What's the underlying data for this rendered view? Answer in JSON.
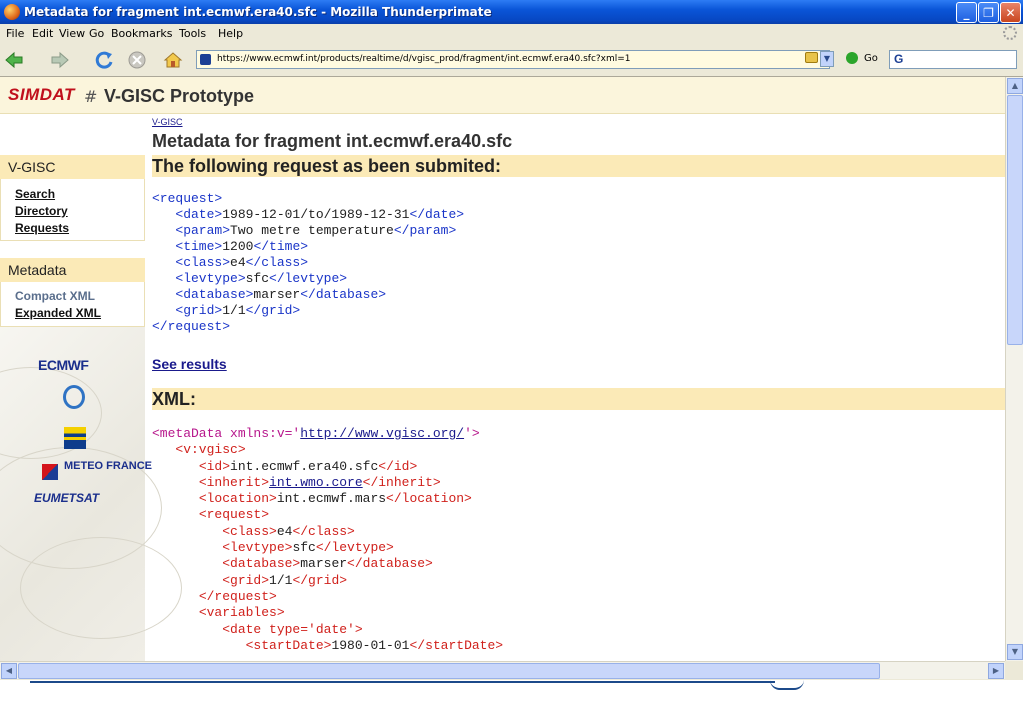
{
  "window": {
    "title": "Metadata for fragment int.ecmwf.era40.sfc - Mozilla Thunderprimate"
  },
  "menu": [
    "File",
    "Edit",
    "View",
    "Go",
    "Bookmarks",
    "Tools",
    "Help"
  ],
  "toolbar": {
    "url": "https://www.ecmwf.int/products/realtime/d/vgisc_prod/fragment/int.ecmwf.era40.sfc?xml=1",
    "go_label": "Go",
    "search_engine": "G"
  },
  "site": {
    "logo_text": "SIMDAT",
    "logo_symbol": "#",
    "title": "V-GISC Prototype"
  },
  "sidebar": {
    "section1": {
      "title": "V-GISC",
      "links": [
        "Search",
        "Directory",
        "Requests"
      ]
    },
    "section2": {
      "title": "Metadata",
      "links": [
        "Compact XML",
        "Expanded XML"
      ]
    },
    "partners": [
      "ECMWF",
      "WMO",
      "Met Office",
      "METEO FRANCE",
      "EUMETSAT"
    ]
  },
  "main": {
    "breadcrumb": "V-GISC",
    "title": "Metadata for fragment int.ecmwf.era40.sfc",
    "section1_title": "The following request as been submited:",
    "request": {
      "open": "<request>",
      "close": "</request>",
      "fields": [
        {
          "tag": "date",
          "value": "1989-12-01/to/1989-12-31"
        },
        {
          "tag": "param",
          "value": "Two metre temperature"
        },
        {
          "tag": "time",
          "value": "1200"
        },
        {
          "tag": "class",
          "value": "e4"
        },
        {
          "tag": "levtype",
          "value": "sfc"
        },
        {
          "tag": "database",
          "value": "marser"
        },
        {
          "tag": "grid",
          "value": "1/1"
        }
      ]
    },
    "see_results": "See results",
    "section2_title": "XML:",
    "xml": {
      "root_open": "<metaData xmlns:v='",
      "root_ns": "http://www.vgisc.org/",
      "root_close": "'>",
      "vgisc": "<v:vgisc>",
      "id": "int.ecmwf.era40.sfc",
      "inherit": "int.wmo.core",
      "location": "int.ecmwf.mars",
      "request_fields": [
        {
          "tag": "class",
          "value": "e4"
        },
        {
          "tag": "levtype",
          "value": "sfc"
        },
        {
          "tag": "database",
          "value": "marser"
        },
        {
          "tag": "grid",
          "value": "1/1"
        }
      ],
      "date_open": "<date type='date'>",
      "start_date": "1980-01-01"
    }
  },
  "colors": {
    "band": "#fbeab7",
    "tag_blue": "#1a35c8",
    "tag_red": "#d0211c",
    "tag_magenta": "#b7178c",
    "brand_red": "#c0101c"
  },
  "icons": [
    "back-arrow-icon",
    "forward-arrow-icon",
    "reload-icon",
    "stop-icon",
    "home-icon",
    "lock-icon",
    "go-icon",
    "google-icon"
  ]
}
